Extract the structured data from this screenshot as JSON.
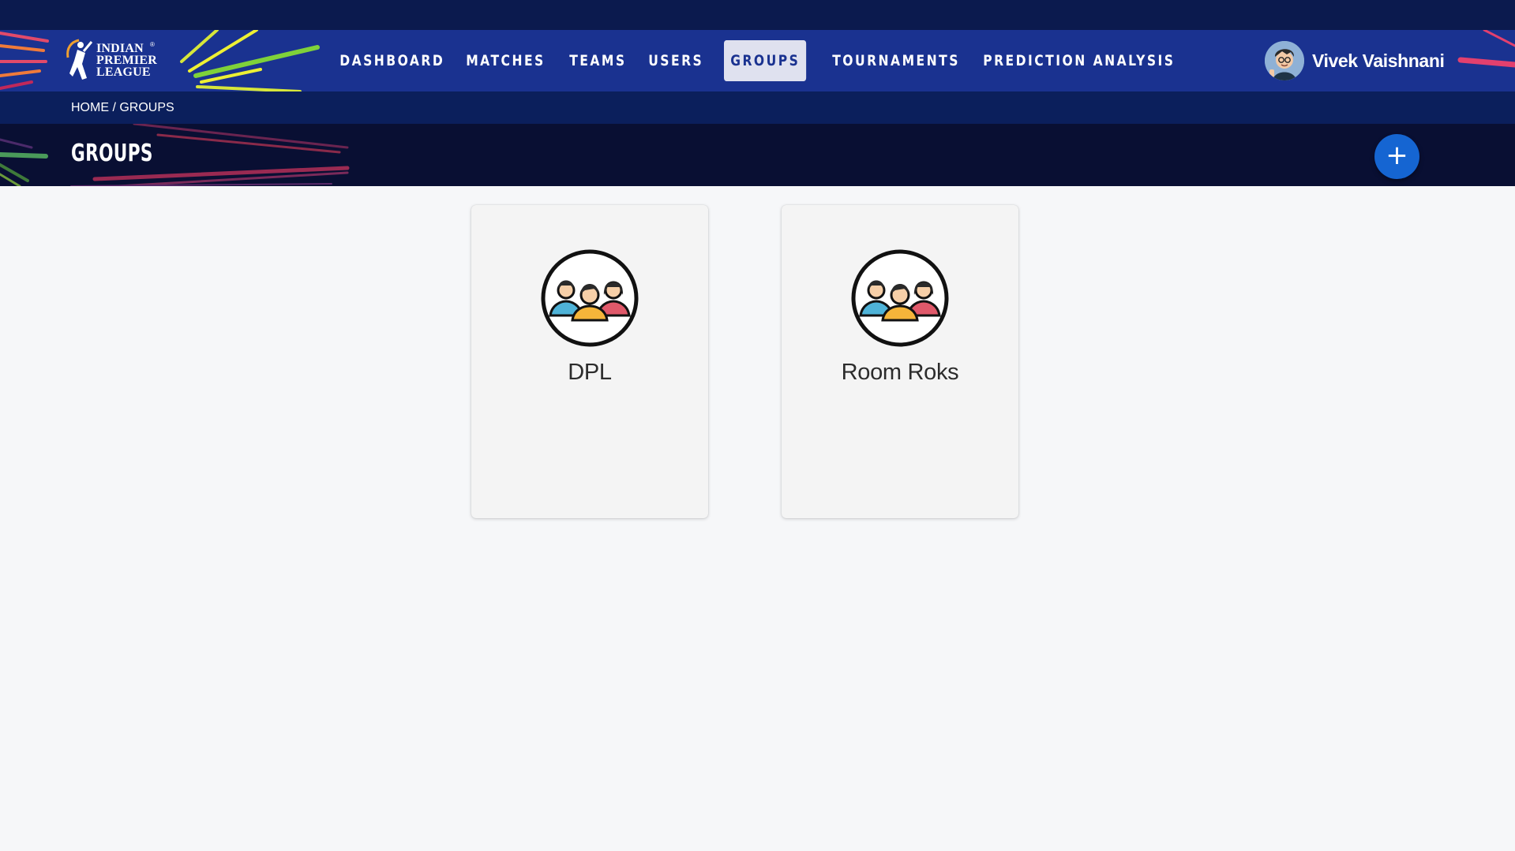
{
  "brand": {
    "logo_lines": [
      "INDIAN",
      "PREMIER",
      "LEAGUE"
    ],
    "registered": "®"
  },
  "nav": {
    "items": [
      {
        "label": "DASHBOARD",
        "key": "dashboard"
      },
      {
        "label": "MATCHES",
        "key": "matches"
      },
      {
        "label": "TEAMS",
        "key": "teams"
      },
      {
        "label": "USERS",
        "key": "users"
      },
      {
        "label": "GROUPS",
        "key": "groups",
        "active": true
      },
      {
        "label": "TOURNAMENTS",
        "key": "tournaments"
      },
      {
        "label": "PREDICTION ANALYSIS",
        "key": "prediction-analysis"
      }
    ]
  },
  "user": {
    "name": "Vivek Vaishnani",
    "avatar_icon": "user-avatar-icon"
  },
  "breadcrumb": {
    "home": "HOME",
    "separator": "/",
    "current": "GROUPS"
  },
  "page": {
    "title": "GROUPS",
    "add_label": "+"
  },
  "groups": [
    {
      "name": "DPL",
      "icon": "group-people-icon"
    },
    {
      "name": "Room Roks",
      "icon": "group-people-icon"
    }
  ],
  "colors": {
    "nav_bg": "#1a3290",
    "top_strip": "#0b1a4e",
    "title_bg": "#090f33",
    "accent": "#1565d2",
    "active_tab_bg": "#dfe1ef"
  }
}
